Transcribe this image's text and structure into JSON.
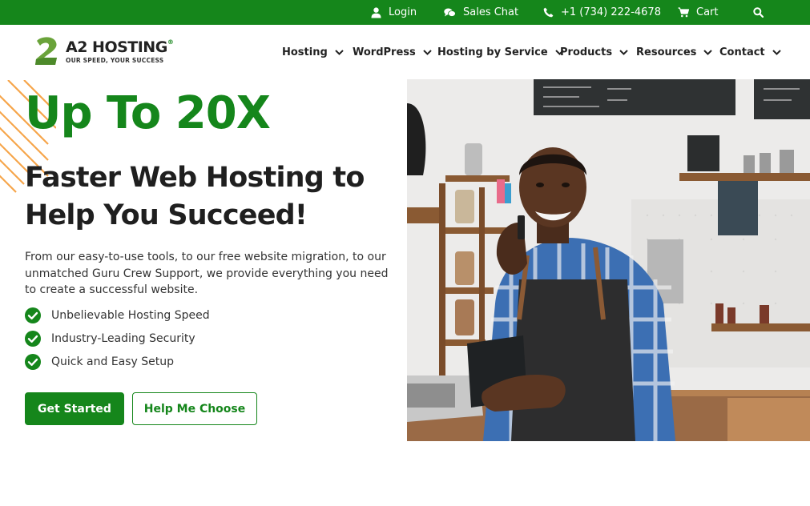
{
  "topbar": {
    "login": "Login",
    "sales_chat": "Sales Chat",
    "phone": "+1 (734) 222-4678",
    "cart": "Cart",
    "icons": [
      "user-icon",
      "chat-icon",
      "phone-icon",
      "cart-icon",
      "search-icon"
    ]
  },
  "logo": {
    "name": "A2 HOSTING",
    "registered": "®",
    "tagline": "OUR SPEED, YOUR SUCCESS"
  },
  "nav": {
    "items": [
      "Hosting",
      "WordPress",
      "Hosting by Service",
      "Products",
      "Resources",
      "Contact"
    ]
  },
  "hero": {
    "kicker": "Up To 20X",
    "title": "Faster Web Hosting to Help You Succeed!",
    "description": "From our easy-to-use tools, to our free website migration, to our unmatched Guru Crew Support, we provide everything you need to create a successful website.",
    "features": [
      "Unbelievable Hosting Speed",
      "Industry-Leading Security",
      "Quick and Easy Setup"
    ],
    "primary_button": "Get Started",
    "secondary_button": "Help Me Choose"
  },
  "colors": {
    "brand_green": "#15861b",
    "accent_orange": "#f6a54a",
    "text_dark": "#1f1f1f"
  }
}
